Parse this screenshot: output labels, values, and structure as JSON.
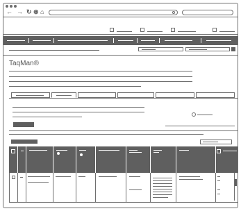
{
  "page": {
    "product_title": "TaqMan®"
  }
}
